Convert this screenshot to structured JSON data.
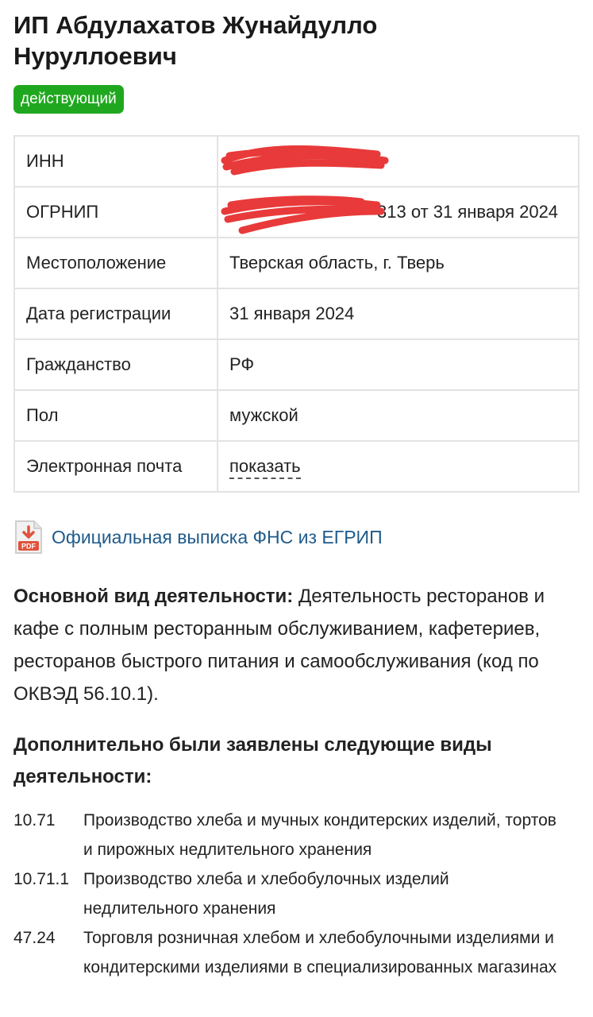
{
  "title": "ИП Абдулахатов Жунайдулло Нуруллоевич",
  "status_badge": "действующий",
  "info_rows": [
    {
      "key": "ИНН",
      "value": "",
      "redacted": true
    },
    {
      "key": "ОГРНИП",
      "value": "313 от 31 января 2024",
      "redacted": true
    },
    {
      "key": "Местоположение",
      "value": "Тверская область, г. Тверь"
    },
    {
      "key": "Дата регистрации",
      "value": "31 января 2024"
    },
    {
      "key": "Гражданство",
      "value": "РФ"
    },
    {
      "key": "Пол",
      "value": "мужской"
    },
    {
      "key": "Электронная почта",
      "value": "показать"
    }
  ],
  "fns_link": {
    "label": "Официальная выписка ФНС из ЕГРИП",
    "icon": "pdf-icon",
    "icon_text": "PDF"
  },
  "main_activity": {
    "label": "Основной вид деятельности:",
    "text": "Деятельность ресторанов и кафе с полным ресторанным обслуживанием, кафетериев, ресторанов быстрого питания и самообслуживания (код по ОКВЭД 56.10.1)."
  },
  "additional_heading": "Дополнительно были заявлены следующие виды деятельности:",
  "additional_activities": [
    {
      "code": "10.71",
      "name": "Производство хлеба и мучных кондитерских изделий, тортов и пирожных недлительного хранения"
    },
    {
      "code": "10.71.1",
      "name": "Производство хлеба и хлебобулочных изделий недлительного хранения"
    },
    {
      "code": "47.24",
      "name": "Торговля розничная хлебом и хлебобулочными изделиями и кондитерскими изделиями в специализированных магазинах"
    }
  ],
  "colors": {
    "badge": "#1fa81f",
    "link": "#1f5a8a",
    "redaction": "#e83a3a",
    "pdf": "#e0533d"
  }
}
